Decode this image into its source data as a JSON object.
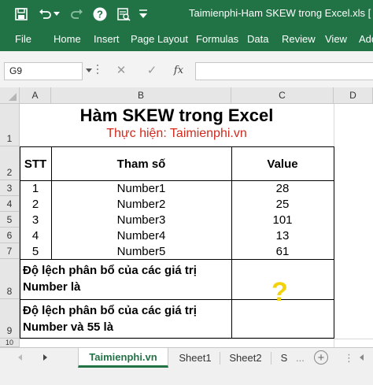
{
  "window": {
    "title": "Taimienphi-Ham SKEW trong Excel.xls [",
    "accent": "#217346"
  },
  "quick_access": [
    "save-icon",
    "undo-icon",
    "redo-icon",
    "help-icon",
    "print-preview-icon",
    "customize-icon"
  ],
  "ribbon": {
    "tabs": [
      "File",
      "Home",
      "Insert",
      "Page Layout",
      "Formulas",
      "Data",
      "Review",
      "View",
      "Add"
    ]
  },
  "formula_bar": {
    "name_box": "G9",
    "cancel": "✕",
    "enter": "✓",
    "fx": "fx",
    "value": ""
  },
  "grid": {
    "columns": [
      "A",
      "B",
      "C",
      "D"
    ],
    "rows": [
      "1",
      "2",
      "3",
      "4",
      "5",
      "6",
      "7",
      "8",
      "9",
      "10"
    ]
  },
  "sheet": {
    "title": "Hàm SKEW trong Excel",
    "subtitle": "Thực hiện: Taimienphi.vn",
    "subtitle_color": "#d12b1f",
    "headers": [
      "STT",
      "Tham số",
      "Value"
    ],
    "rows": [
      {
        "stt": "1",
        "param": "Number1",
        "value": "28"
      },
      {
        "stt": "2",
        "param": "Number2",
        "value": "25"
      },
      {
        "stt": "3",
        "param": "Number3",
        "value": "101"
      },
      {
        "stt": "4",
        "param": "Number4",
        "value": "13"
      },
      {
        "stt": "5",
        "param": "Number5",
        "value": "61"
      }
    ],
    "question1": [
      "Độ lệch phân bổ của các giá trị",
      "Number là"
    ],
    "question2": [
      "Độ lệch phân bổ của các giá trị",
      "Number và 55 là"
    ],
    "answer_placeholder": "?"
  },
  "sheet_tabs": {
    "tabs": [
      "Taimienphi.vn",
      "Sheet1",
      "Sheet2",
      "S"
    ],
    "active": "Taimienphi.vn",
    "add": "+",
    "more": "..."
  }
}
